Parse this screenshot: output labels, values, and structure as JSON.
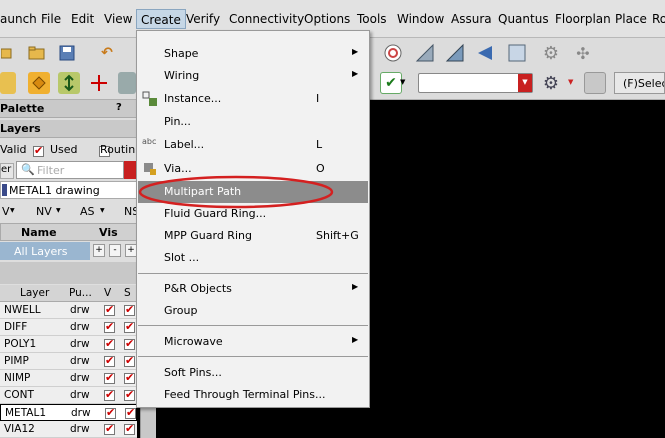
{
  "menubar": {
    "items": [
      "aunch",
      "File",
      "Edit",
      "View",
      "Create",
      "Verify",
      "Connectivity",
      "Options",
      "Tools",
      "Window",
      "Assura",
      "Quantus",
      "Floorplan",
      "Place",
      "Ro"
    ]
  },
  "toolbar": {
    "select_label": "(F)Select"
  },
  "palette": {
    "title": "Palette",
    "help": "?",
    "layers_title": "Layers",
    "valid_label": "Valid",
    "used_label": "Used",
    "routing_label": "Routin",
    "filter_prefix": "er",
    "filter_placeholder": "Filter",
    "current_layer": "METAL1 drawing",
    "vis_buttons": [
      "V",
      "NV",
      "AS",
      "NS"
    ],
    "table1": {
      "col_name": "Name",
      "col_vis": "Vis",
      "row": "All Layers",
      "btn_plus": "+",
      "btn_minus": "-",
      "btn_plus2": "+"
    },
    "table2": {
      "headers": [
        "Layer",
        "Pu...",
        "V",
        "S"
      ],
      "rows": [
        {
          "layer": "NWELL",
          "purpose": "drw"
        },
        {
          "layer": "DIFF",
          "purpose": "drw"
        },
        {
          "layer": "POLY1",
          "purpose": "drw"
        },
        {
          "layer": "PIMP",
          "purpose": "drw"
        },
        {
          "layer": "NIMP",
          "purpose": "drw"
        },
        {
          "layer": "CONT",
          "purpose": "drw"
        },
        {
          "layer": "METAL1",
          "purpose": "drw"
        },
        {
          "layer": "VIA12",
          "purpose": "drw"
        }
      ]
    }
  },
  "create_menu": {
    "items": [
      {
        "label": "Shape",
        "shortcut": "",
        "submenu": true
      },
      {
        "label": "Wiring",
        "shortcut": "",
        "submenu": true
      },
      {
        "label": "Instance...",
        "shortcut": "I",
        "submenu": false
      },
      {
        "label": "Pin...",
        "shortcut": "",
        "submenu": false
      },
      {
        "label": "Label...",
        "shortcut": "L",
        "submenu": false
      },
      {
        "label": "Via...",
        "shortcut": "O",
        "submenu": false
      },
      {
        "label": "Multipart Path",
        "shortcut": "",
        "submenu": false
      },
      {
        "label": "Fluid Guard Ring...",
        "shortcut": "",
        "submenu": false
      },
      {
        "label": "MPP Guard Ring",
        "shortcut": "Shift+G",
        "submenu": false
      },
      {
        "label": "Slot ...",
        "shortcut": "",
        "submenu": false
      },
      {
        "label": "P&R Objects",
        "shortcut": "",
        "submenu": true
      },
      {
        "label": "Group",
        "shortcut": "",
        "submenu": false
      },
      {
        "label": "Microwave",
        "shortcut": "",
        "submenu": true
      },
      {
        "label": "Soft Pins...",
        "shortcut": "",
        "submenu": false
      },
      {
        "label": "Feed Through Terminal Pins...",
        "shortcut": "",
        "submenu": false
      }
    ],
    "label_icon_text": "abc"
  },
  "colors": {
    "highlight": "#8c8c8c",
    "annotation": "#d42020",
    "check": "#cc0000"
  }
}
